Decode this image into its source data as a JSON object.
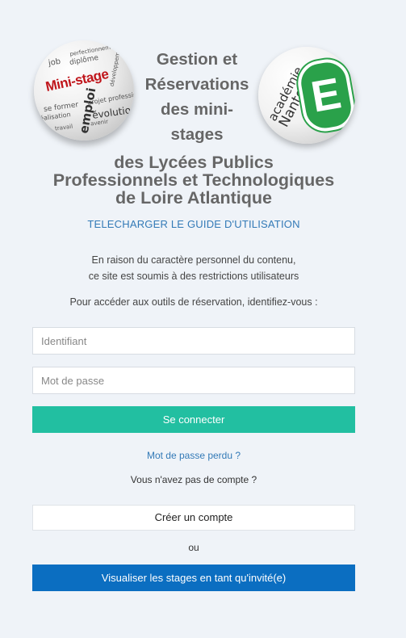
{
  "header": {
    "title_lines_top": "Gestion et Réservations des mini-stages",
    "title_lines_bottom_1": "des Lycées Publics",
    "title_lines_bottom_2": "Professionnels et Technologiques",
    "title_lines_bottom_3": "de Loire Atlantique",
    "logo_left": {
      "main_word": "Mini-stage",
      "words": [
        "perfectionnement",
        "job",
        "diplôme",
        "développement",
        "se former",
        "emploi",
        "projet professionnel",
        "évolution",
        "réalisation",
        "avenir",
        "travail"
      ]
    },
    "logo_right": {
      "text_line_1": "académie",
      "text_line_2": "Nantes",
      "badge_letter": "E"
    }
  },
  "guide_link": "TELECHARGER LE GUIDE D'UTILISATION",
  "notice": {
    "line1": "En raison du caractère personnel du contenu,",
    "line2": "ce site est soumis à des restrictions utilisateurs"
  },
  "identify_prompt": "Pour accéder aux outils de réservation, identifiez-vous :",
  "login": {
    "username": {
      "value": "",
      "placeholder": "Identifiant"
    },
    "password": {
      "value": "",
      "placeholder": "Mot de passe"
    },
    "connect_label": "Se connecter",
    "lost_password": "Mot de passe perdu ?",
    "no_account": "Vous n'avez pas de compte ?",
    "create_account_label": "Créer un compte",
    "or_label": "ou",
    "guest_label": "Visualiser les stages en tant qu'invité(e)"
  },
  "colors": {
    "background": "#eff3f8",
    "connect": "#22bfa1",
    "guest": "#0b6ec1",
    "link": "#337ab7",
    "logo_red": "#c0161c",
    "logo_green": "#2aa14a"
  }
}
